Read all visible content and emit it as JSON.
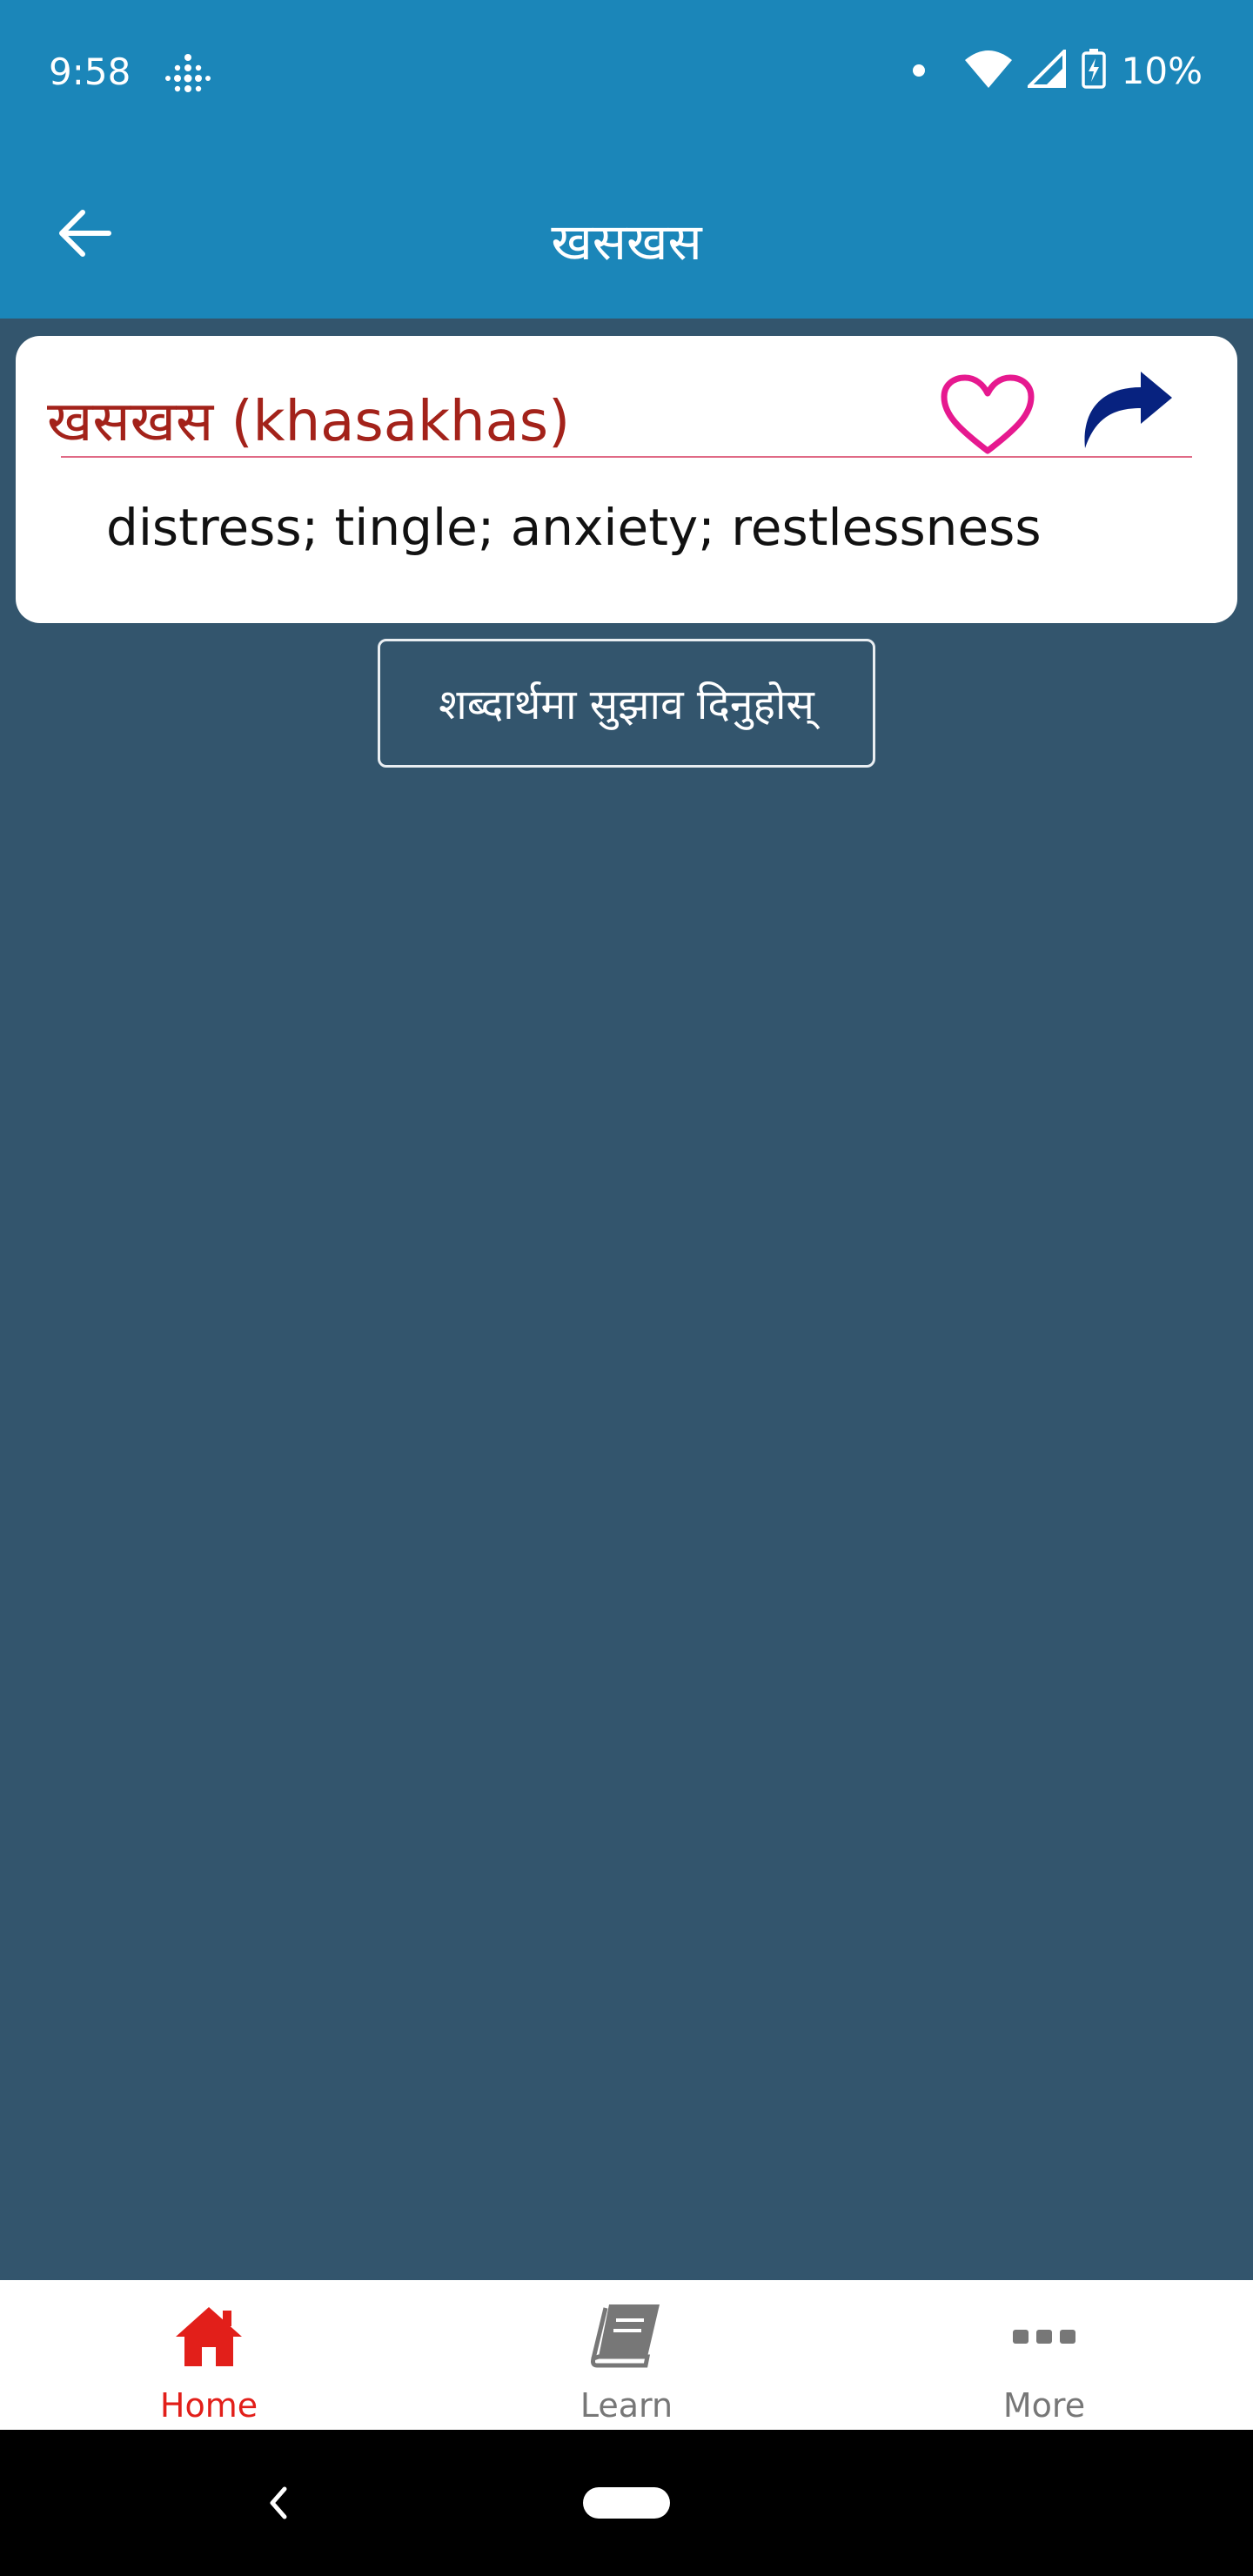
{
  "status_bar": {
    "time": "9:58",
    "battery": "10%",
    "icons": [
      "fitbit-icon",
      "dot-icon",
      "wifi-icon",
      "cellular-icon",
      "battery-charging-icon"
    ]
  },
  "app_bar": {
    "title": "खसखस",
    "back_icon": "arrow-left-icon"
  },
  "word_card": {
    "title": "खसखस (khasakhas)",
    "meaning": "distress; tingle; anxiety; restlessness",
    "favorite_icon": "heart-outline-icon",
    "share_icon": "share-arrow-icon",
    "colors": {
      "title": "#a3221a",
      "divider": "#e06a86",
      "heart": "#e6198f",
      "share": "#07227f"
    }
  },
  "suggest_button": {
    "label": "शब्दार्थमा सुझाव दिनुहोस्"
  },
  "bottom_nav": {
    "items": [
      {
        "label": "Home",
        "icon": "home-icon",
        "active": true
      },
      {
        "label": "Learn",
        "icon": "book-icon",
        "active": false
      },
      {
        "label": "More",
        "icon": "more-horizontal-icon",
        "active": false
      }
    ],
    "active_color": "#e21f1a"
  },
  "theme": {
    "appbar": "#1b86b9",
    "background": "#33556d"
  }
}
